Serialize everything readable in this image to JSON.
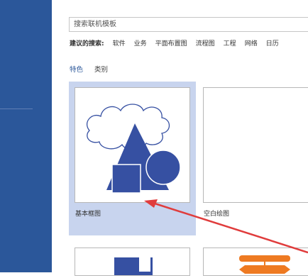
{
  "search": {
    "placeholder": "搜索联机模板"
  },
  "suggested": {
    "label": "建议的搜索:",
    "items": [
      "软件",
      "业务",
      "平面布置图",
      "流程图",
      "工程",
      "网络",
      "日历"
    ]
  },
  "tabs": [
    {
      "label": "特色",
      "active": true
    },
    {
      "label": "类别",
      "active": false
    }
  ],
  "templates": [
    {
      "caption": "基本框图",
      "selected": true
    },
    {
      "caption": "空白绘图",
      "selected": false
    }
  ],
  "colors": {
    "accent": "#2b579a",
    "shape_fill": "#3650a2",
    "selected_bg": "#c8d4ee",
    "annotation_arrow": "#e03c3c"
  }
}
